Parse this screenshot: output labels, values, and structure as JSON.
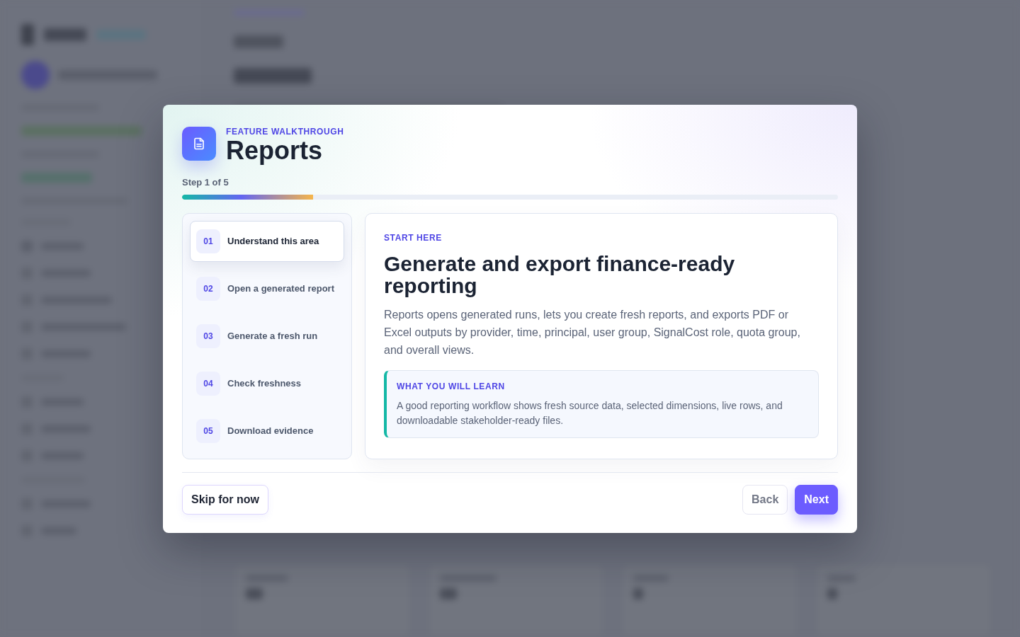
{
  "dialog": {
    "eyebrow": "FEATURE WALKTHROUGH",
    "title": "Reports",
    "step_label": "Step 1 of 5",
    "progress": {
      "level": 0.2
    }
  },
  "steps": [
    {
      "number": "01",
      "label": "Understand this area",
      "selected": true
    },
    {
      "number": "02",
      "label": "Open a generated report",
      "selected": false
    },
    {
      "number": "03",
      "label": "Generate a fresh run",
      "selected": false
    },
    {
      "number": "04",
      "label": "Check freshness",
      "selected": false
    },
    {
      "number": "05",
      "label": "Download evidence",
      "selected": false
    }
  ],
  "content": {
    "eyebrow": "START HERE",
    "heading": "Generate and export finance-ready reporting",
    "body": "Reports opens generated runs, lets you create fresh reports, and exports PDF or Excel outputs by provider, time, principal, user group, SignalCost role, quota group, and overall views.",
    "callout": {
      "title": "WHAT YOU WILL LEARN",
      "text": "A good reporting workflow shows fresh source data, selected dimensions, live rows, and downloadable stakeholder-ready files."
    }
  },
  "footer": {
    "skip_button": "Skip for now",
    "back_button": "Back",
    "next_button": "Next"
  }
}
